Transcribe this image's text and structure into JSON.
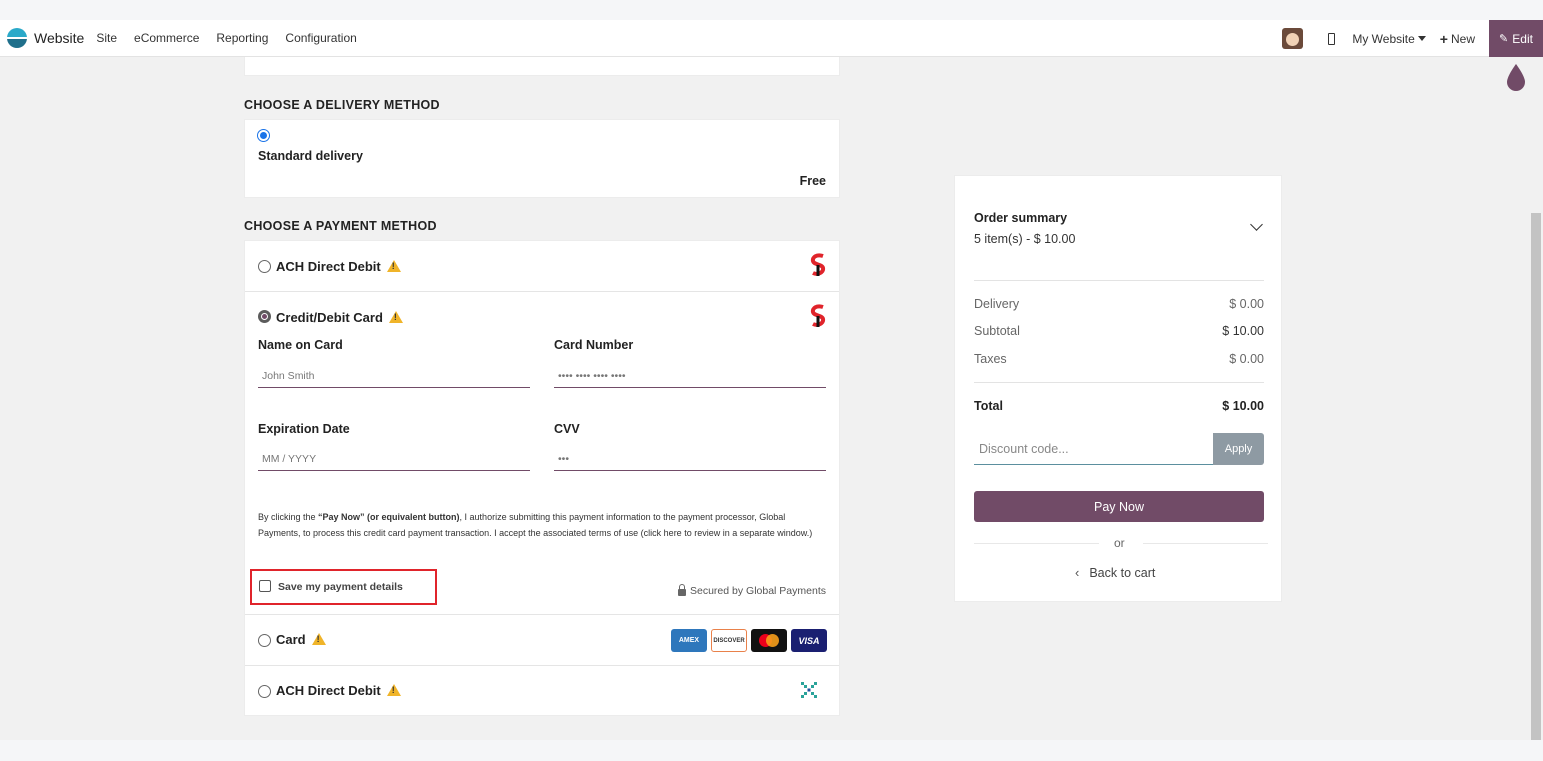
{
  "topbar": {
    "brand": "Website",
    "menu": [
      "Site",
      "eCommerce",
      "Reporting",
      "Configuration"
    ],
    "my_website": "My Website",
    "new_label": "New",
    "edit_label": "Edit"
  },
  "delivery": {
    "section_title": "CHOOSE A DELIVERY METHOD",
    "option_label": "Standard delivery",
    "price": "Free"
  },
  "payment": {
    "section_title": "CHOOSE A PAYMENT METHOD",
    "methods": [
      {
        "label": "ACH Direct Debit"
      },
      {
        "label": "Credit/Debit Card"
      },
      {
        "label": "Card"
      },
      {
        "label": "ACH Direct Debit"
      }
    ],
    "form": {
      "name_label": "Name on Card",
      "name_placeholder": "John Smith",
      "number_label": "Card Number",
      "number_placeholder": "•••• •••• •••• ••••",
      "expiry_label": "Expiration Date",
      "expiry_placeholder": "MM / YYYY",
      "cvv_label": "CVV",
      "cvv_placeholder": "•••"
    },
    "consent": {
      "part1": "By clicking the ",
      "bold": "“Pay Now” (or equivalent button)",
      "part2": ", I authorize submitting this payment information to the payment processor, Global Payments, to process this credit card payment transaction. I accept the associated terms of use (click here to review in a separate window.)"
    },
    "save_label": "Save my payment details",
    "secured_label": "Secured by Global Payments",
    "card_brands": [
      "AMEX",
      "DISCOVER",
      "Mastercard",
      "VISA"
    ]
  },
  "summary": {
    "title": "Order summary",
    "items": "5 item(s) -  $ 10.00",
    "rows": [
      {
        "label": "Delivery",
        "value": "$ 0.00"
      },
      {
        "label": "Subtotal",
        "value": "$ 10.00"
      },
      {
        "label": "Taxes",
        "value": "$ 0.00"
      }
    ],
    "total_label": "Total",
    "total_value": "$ 10.00",
    "discount_placeholder": "Discount code...",
    "apply_label": "Apply",
    "pay_label": "Pay Now",
    "or_label": "or",
    "back_label": "Back to cart"
  },
  "colors": {
    "primary": "#714b67",
    "highlight": "#e0242b",
    "warning": "#f0b429"
  }
}
